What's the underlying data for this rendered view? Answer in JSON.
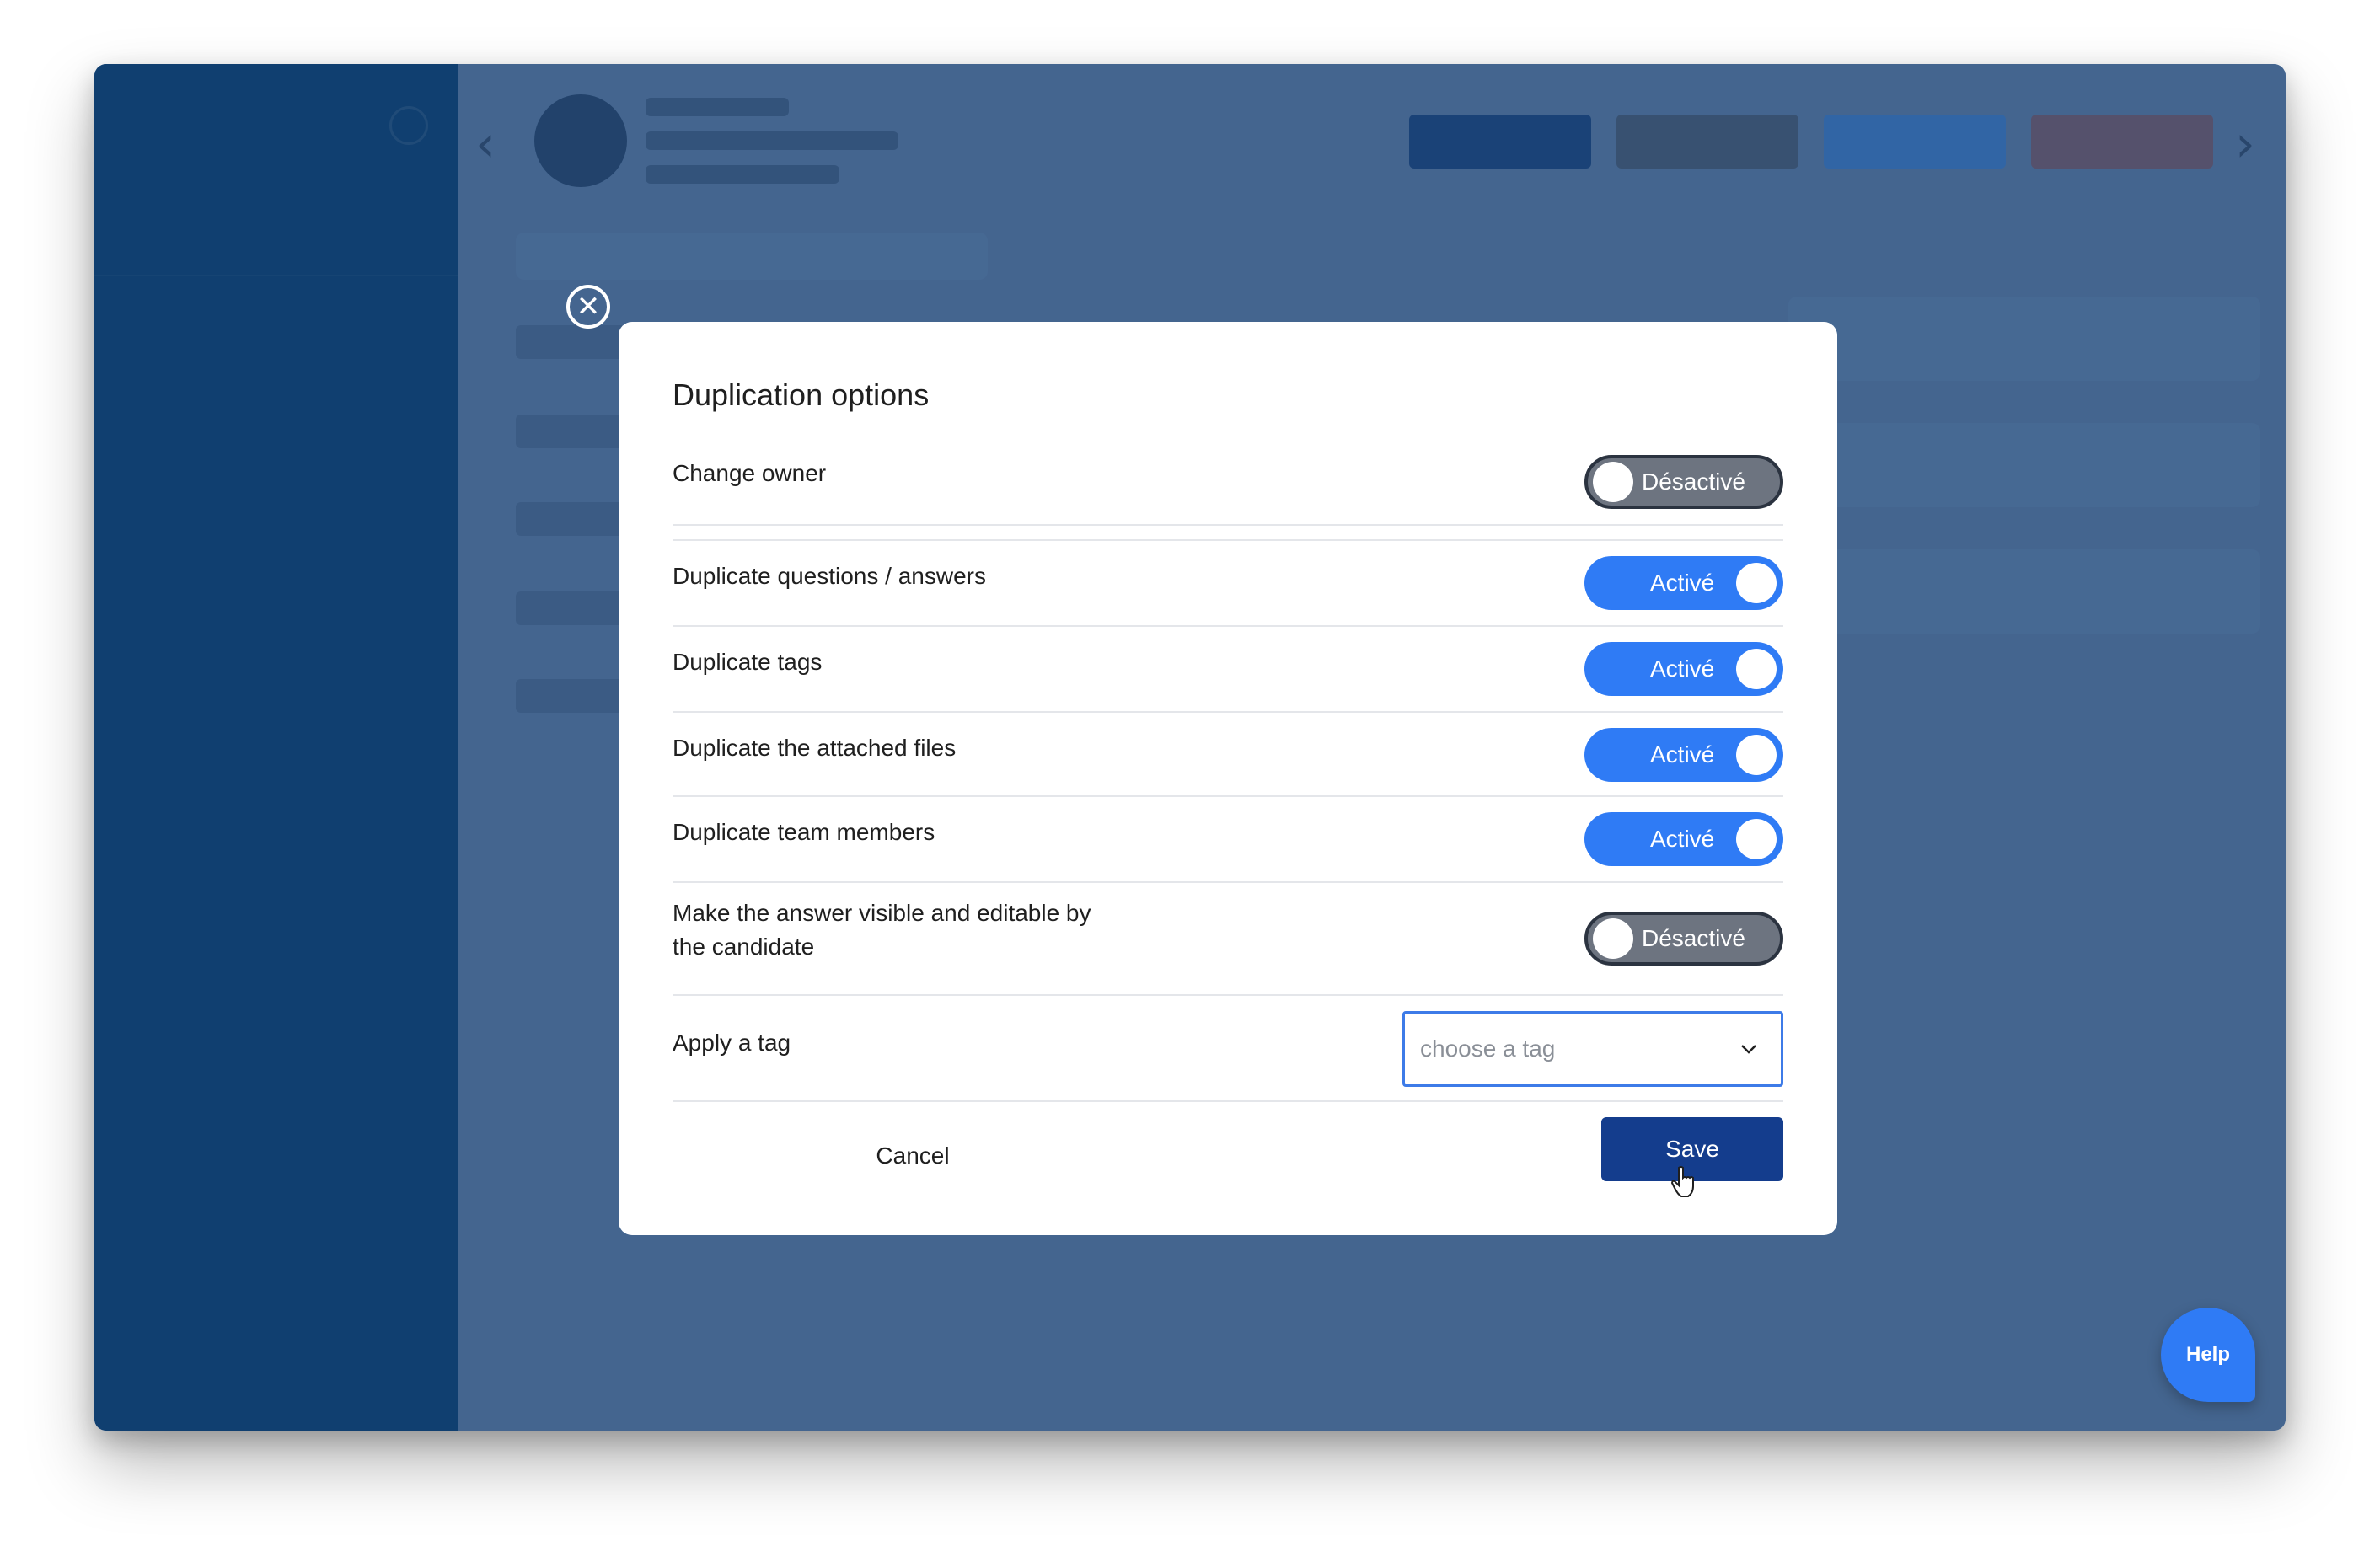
{
  "modal": {
    "title": "Duplication options",
    "close_icon": "close-circle-icon",
    "options": [
      {
        "label": "Change owner",
        "state": "Désactivé",
        "enabled": false
      },
      {
        "label": "Duplicate questions / answers",
        "state": "Activé",
        "enabled": true
      },
      {
        "label": "Duplicate tags",
        "state": "Activé",
        "enabled": true
      },
      {
        "label": "Duplicate the attached files",
        "state": "Activé",
        "enabled": true
      },
      {
        "label": "Duplicate team members",
        "state": "Activé",
        "enabled": true
      },
      {
        "label": "Make the answer visible and editable by the candidate",
        "state": "Désactivé",
        "enabled": false
      }
    ],
    "tag": {
      "label": "Apply a tag",
      "placeholder": "choose a tag",
      "icon": "chevron-down-icon"
    },
    "cancel_label": "Cancel",
    "save_label": "Save"
  },
  "help": {
    "label": "Help"
  },
  "colors": {
    "toggle_on": "#2f7bf5",
    "toggle_off": "#6d7480",
    "save_button": "#143d8d",
    "select_border": "#3d7be8"
  }
}
